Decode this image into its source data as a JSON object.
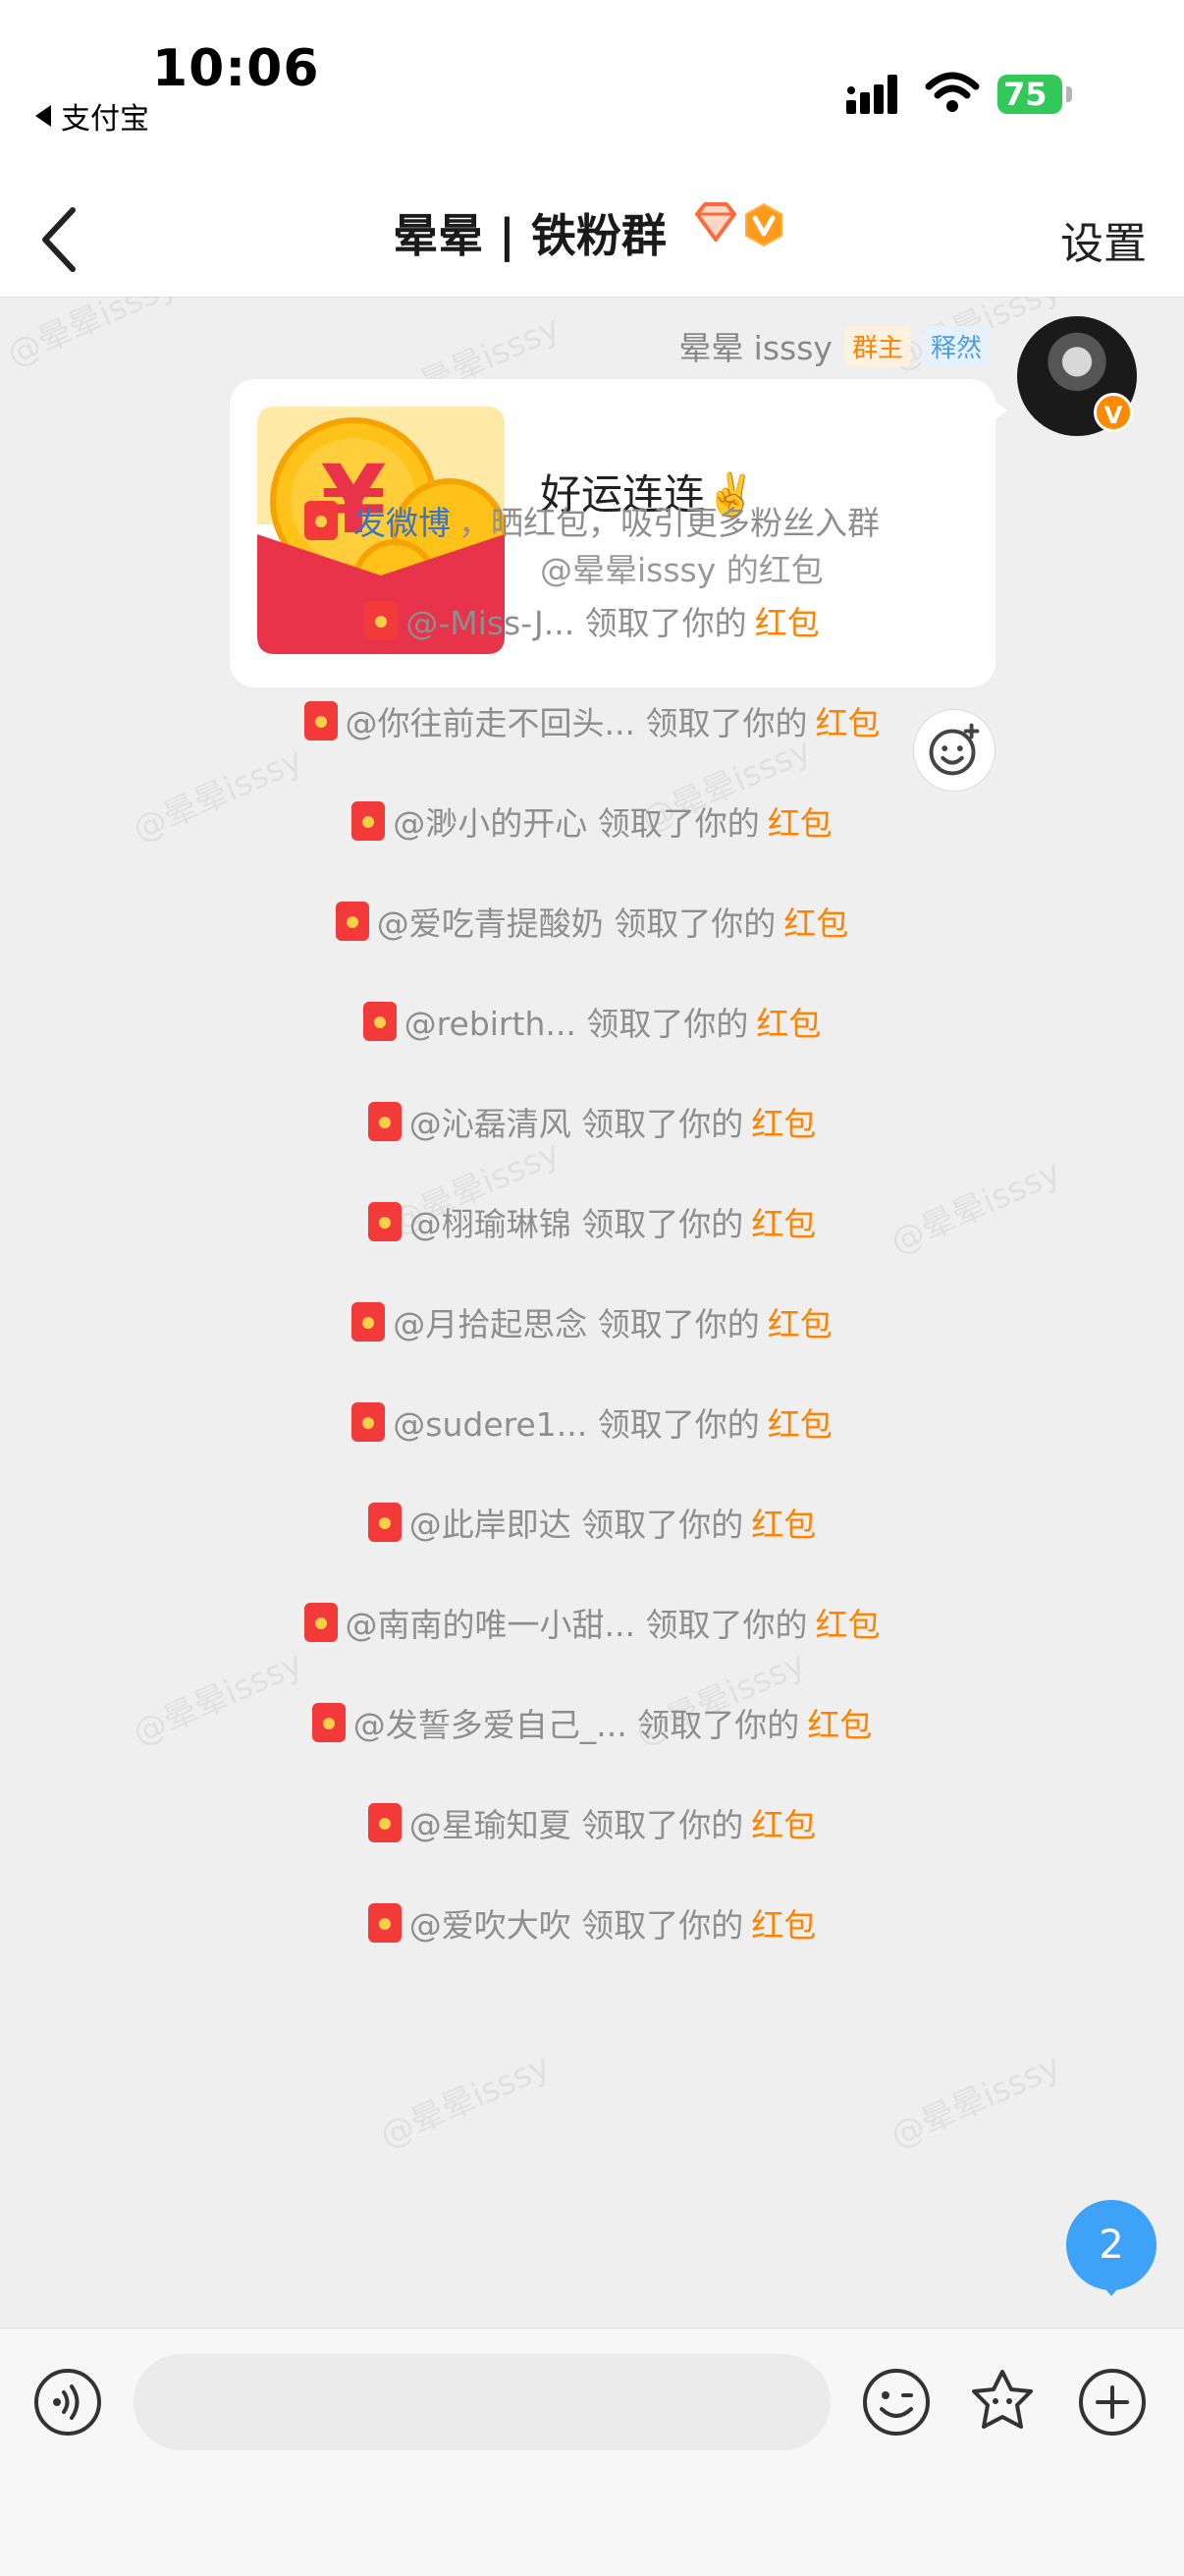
{
  "status_bar": {
    "time": "10:06",
    "back_app": "支付宝",
    "battery": "75"
  },
  "nav": {
    "title": "晕晕 | 铁粉群",
    "settings": "设置"
  },
  "watermark": "@晕晕isssy",
  "message": {
    "sender_name": "晕晕 isssy",
    "owner_tag": "群主",
    "title_tag": "释然",
    "red_packet_title": "好运连连✌️",
    "red_packet_sub": "@晕晕isssy 的红包"
  },
  "system_rows": [
    {
      "pre": "",
      "link": "发微博",
      "text": "，晒红包，吸引更多粉丝入群",
      "tail": ""
    },
    {
      "pre": "@-Miss-J... 领取了你的",
      "link": "",
      "text": "",
      "tail": "红包"
    },
    {
      "pre": "@你往前走不回头... 领取了你的",
      "link": "",
      "text": "",
      "tail": "红包"
    },
    {
      "pre": "@渺小的开心 领取了你的",
      "link": "",
      "text": "",
      "tail": "红包"
    },
    {
      "pre": "@爱吃青提酸奶 领取了你的",
      "link": "",
      "text": "",
      "tail": "红包"
    },
    {
      "pre": "@rebirth... 领取了你的",
      "link": "",
      "text": "",
      "tail": "红包"
    },
    {
      "pre": "@沁磊清风 领取了你的",
      "link": "",
      "text": "",
      "tail": "红包"
    },
    {
      "pre": "@栩瑜琳锦 领取了你的",
      "link": "",
      "text": "",
      "tail": "红包"
    },
    {
      "pre": "@月拾起思念 领取了你的",
      "link": "",
      "text": "",
      "tail": "红包"
    },
    {
      "pre": "@sudere1... 领取了你的",
      "link": "",
      "text": "",
      "tail": "红包"
    },
    {
      "pre": "@此岸即达 领取了你的",
      "link": "",
      "text": "",
      "tail": "红包"
    },
    {
      "pre": "@南南的唯一小甜... 领取了你的",
      "link": "",
      "text": "",
      "tail": "红包"
    },
    {
      "pre": "@发誓多爱自己_... 领取了你的",
      "link": "",
      "text": "",
      "tail": "红包"
    },
    {
      "pre": "@星瑜知夏 领取了你的",
      "link": "",
      "text": "",
      "tail": "红包"
    },
    {
      "pre": "@爱吹大吹 领取了你的",
      "link": "",
      "text": "",
      "tail": "红包"
    }
  ],
  "unread_count": "2",
  "input": {
    "placeholder": ""
  },
  "colors": {
    "link": "#3a75c4",
    "accent_orange": "#ff8200",
    "unread_blue": "#3ea2f6",
    "red_packet": "#e8334a"
  }
}
